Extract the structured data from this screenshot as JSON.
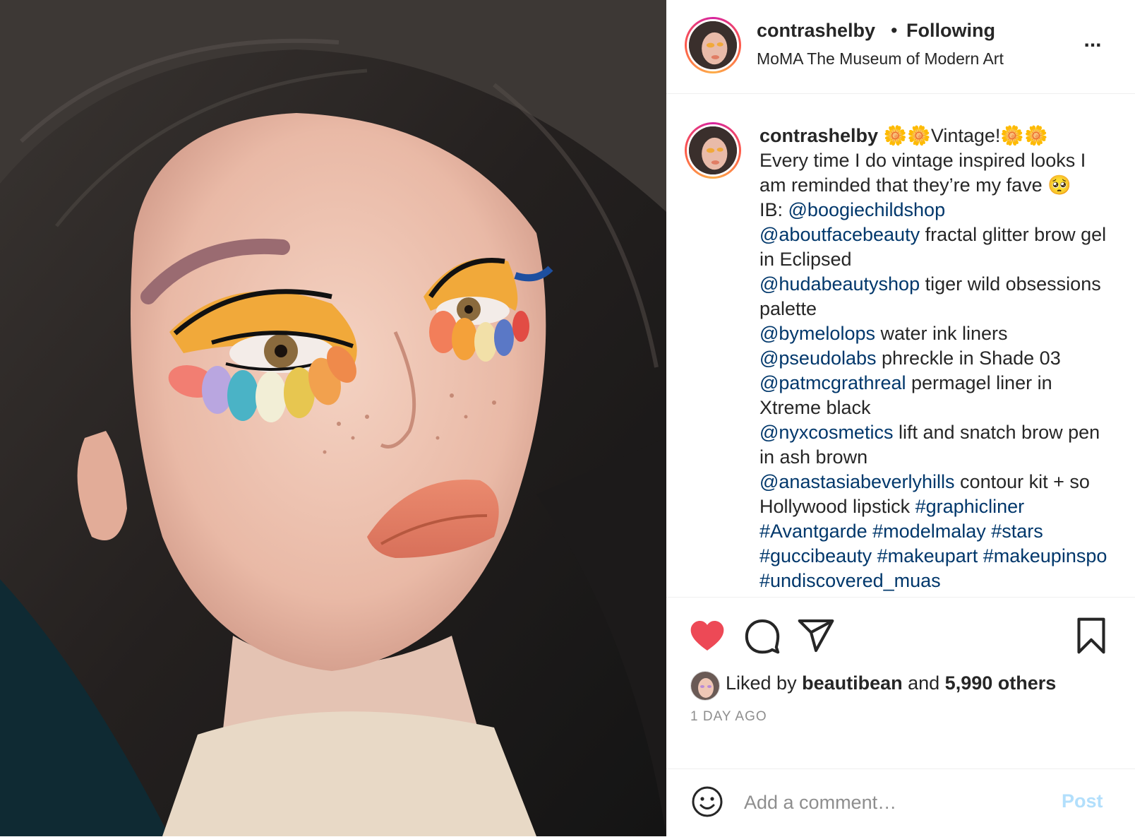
{
  "post": {
    "username": "contrashelby",
    "separator": "•",
    "follow_status": "Following",
    "location": "MoMA The Museum of Modern Art",
    "more_icon": "more-options-icon",
    "more_label": "..."
  },
  "caption": {
    "username": "contrashelby",
    "title": "🌼🌼Vintage!🌼🌼",
    "line1": "Every time I do vintage inspired looks I am reminded that they’re my fave 🥺",
    "ib_prefix": "IB: ",
    "mentions": [
      {
        "handle": "@boogiechildshop",
        "text": ""
      },
      {
        "handle": "@aboutfacebeauty",
        "text": " fractal glitter brow gel in Eclipsed"
      },
      {
        "handle": "@hudabeautyshop",
        "text": " tiger wild obsessions palette"
      },
      {
        "handle": "@bymelolops",
        "text": " water ink liners"
      },
      {
        "handle": "@pseudolabs",
        "text": " phreckle in Shade 03"
      },
      {
        "handle": "@patmcgrathreal",
        "text": " permagel liner in Xtreme black"
      },
      {
        "handle": "@nyxcosmetics",
        "text": " lift and snatch brow pen in ash brown"
      },
      {
        "handle": "@anastasiabeverlyhills",
        "text": " contour kit + so Hollywood lipstick "
      }
    ],
    "hashtags": [
      "#graphicliner",
      "#Avantgarde",
      "#modelmalay",
      "#stars",
      "#guccibeauty",
      "#makeupart",
      "#makeupinspo",
      "#undiscovered_muas"
    ]
  },
  "actions": {
    "like_icon": "heart-filled-icon",
    "comment_icon": "comment-icon",
    "share_icon": "share-icon",
    "save_icon": "bookmark-icon",
    "like_color": "#ed4956"
  },
  "likes": {
    "prefix": "Liked by ",
    "user": "beautibean",
    "middle": " and ",
    "others": "5,990 others"
  },
  "timestamp": "1 DAY AGO",
  "comment_box": {
    "placeholder": "Add a comment…",
    "post_label": "Post",
    "post_color": "#b2dffc"
  }
}
